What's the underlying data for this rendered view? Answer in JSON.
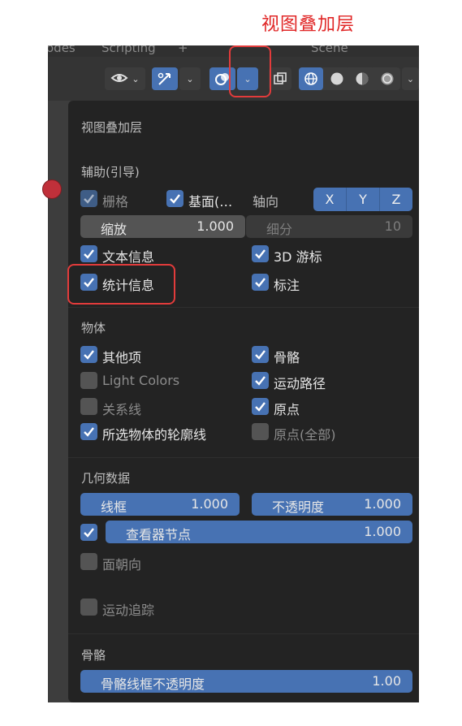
{
  "annotation": {
    "title": "视图叠加层"
  },
  "top_strip": {
    "left_text": "odes",
    "mid_text": "Scripting",
    "plus": "+",
    "right_text": "Scene"
  },
  "colors": {
    "accent": "#4772b3",
    "panel_bg": "#232323",
    "annotation": "#e02626"
  },
  "panel": {
    "title": "视图叠加层",
    "guides": {
      "header": "辅助(引导)",
      "grid": {
        "label": "栅格",
        "checked": true
      },
      "floor": {
        "label": "基面(…",
        "checked": true
      },
      "axes_label": "轴向",
      "axes": [
        "X",
        "Y",
        "Z"
      ],
      "scale": {
        "label": "缩放",
        "value": "1.000"
      },
      "subdivision": {
        "label": "细分",
        "value": "10"
      },
      "text_info": {
        "label": "文本信息",
        "checked": true
      },
      "cursor_3d": {
        "label": "3D 游标",
        "checked": true
      },
      "statistics": {
        "label": "统计信息",
        "checked": true
      },
      "annotations": {
        "label": "标注",
        "checked": true
      }
    },
    "objects": {
      "header": "物体",
      "extras": {
        "label": "其他项",
        "checked": true
      },
      "bones": {
        "label": "骨骼",
        "checked": true
      },
      "light_colors": {
        "label": "Light Colors",
        "checked": false
      },
      "motion_paths": {
        "label": "运动路径",
        "checked": true
      },
      "relationship_lines": {
        "label": "关系线",
        "checked": false
      },
      "origins": {
        "label": "原点",
        "checked": true
      },
      "outline_selected": {
        "label": "所选物体的轮廓线",
        "checked": true
      },
      "origins_all": {
        "label": "原点(全部)",
        "checked": false
      }
    },
    "geometry": {
      "header": "几何数据",
      "wireframe": {
        "label": "线框",
        "value": "1.000"
      },
      "opacity": {
        "label": "不透明度",
        "value": "1.000"
      },
      "viewer_node": {
        "label": "查看器节点",
        "value": "1.000",
        "checked": true
      },
      "face_orientation": {
        "label": "面朝向",
        "checked": false
      },
      "motion_tracking": {
        "label": "运动追踪",
        "checked": false
      }
    },
    "bone": {
      "header": "骨骼",
      "wire_opacity": {
        "label": "骨骼线框不透明度",
        "value": "1.00"
      }
    }
  }
}
